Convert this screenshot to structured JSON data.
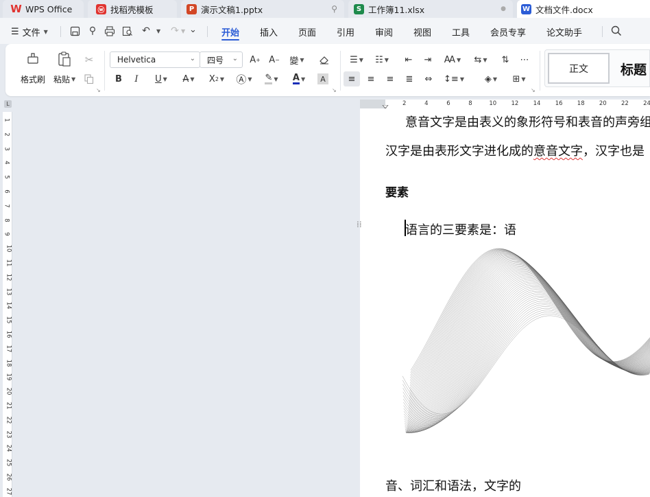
{
  "tabs": [
    {
      "label": "WPS Office",
      "icon": "wps-logo-icon",
      "color": "#e0332f"
    },
    {
      "label": "找稻壳模板",
      "icon": "docer-icon",
      "color": "#e0332f"
    },
    {
      "label": "演示文稿1.pptx",
      "icon": "ppt-icon",
      "color": "#d24625"
    },
    {
      "label": "工作簿11.xlsx",
      "icon": "sheet-icon",
      "color": "#1e8a4c"
    },
    {
      "label": "文档文件.docx",
      "icon": "word-icon",
      "color": "#2b5cd6"
    }
  ],
  "tab_icon_letters": {
    "ppt": "P",
    "sheet": "S",
    "word": "W"
  },
  "menu": {
    "file_label": "文件",
    "items": [
      "开始",
      "插入",
      "页面",
      "引用",
      "审阅",
      "视图",
      "工具",
      "会员专享",
      "论文助手"
    ],
    "active": "开始",
    "accent": "#2b5cd6"
  },
  "ribbon": {
    "format_painter": "格式刷",
    "paste": "粘贴",
    "font_name": "Helvetica",
    "font_size": "四号",
    "style_normal": "正文",
    "style_heading": "标题"
  },
  "ruler": {
    "h_ticks": [
      "2",
      "4",
      "6",
      "8",
      "10",
      "12",
      "14",
      "16",
      "18",
      "20",
      "22",
      "24"
    ],
    "v_ticks": [
      "1",
      "2",
      "3",
      "4",
      "5",
      "6",
      "7",
      "8",
      "9",
      "10",
      "11",
      "12",
      "13",
      "14",
      "15",
      "16",
      "17",
      "18",
      "19",
      "20",
      "21",
      "22",
      "23",
      "24",
      "25",
      "26",
      "27"
    ]
  },
  "document": {
    "line1": "意音文字是由表义的象形符号和表音的声旁组",
    "line2_a": "汉字是由表形文字进化成的",
    "line2_b": "意音文字",
    "line2_c": "，汉字也是",
    "heading": "要素",
    "line3": "语言的三要素是：语",
    "line4": "音、词汇和语法，文字的"
  }
}
